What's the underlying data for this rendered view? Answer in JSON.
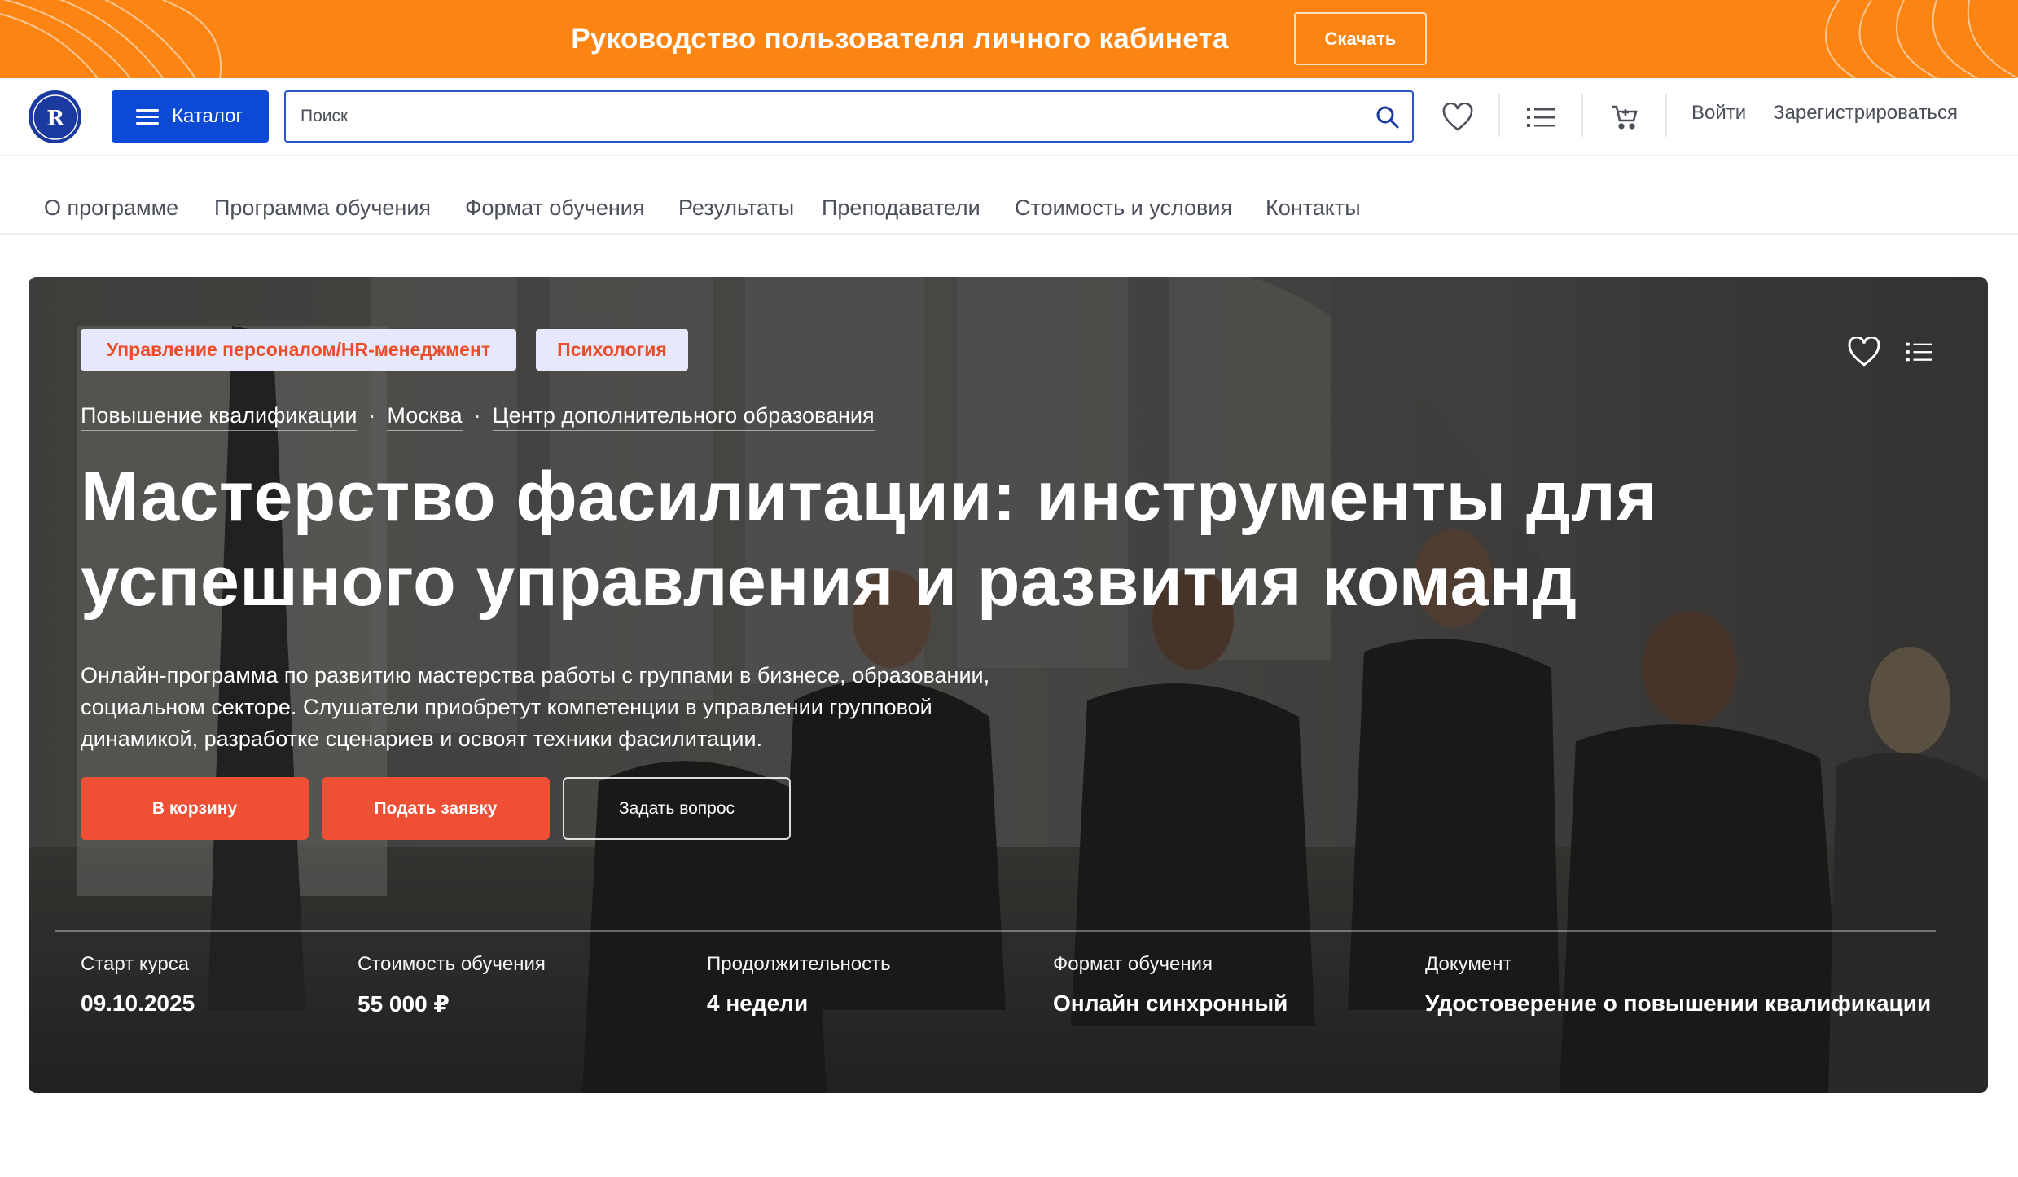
{
  "banner": {
    "text": "Руководство пользователя личного кабинета",
    "button": "Скачать",
    "color": "#fb8412"
  },
  "header": {
    "logo_icon": "hse-logo-icon",
    "catalog_label": "Каталог",
    "search_placeholder": "Поиск",
    "login": "Войти",
    "register": "Зарегистрироваться",
    "accent": "#0c4ad6"
  },
  "nav": {
    "items": [
      {
        "label": "О программе"
      },
      {
        "label": "Программа обучения"
      },
      {
        "label": "Формат обучения"
      },
      {
        "label": "Результаты"
      },
      {
        "label": "Преподаватели"
      },
      {
        "label": "Стоимость и условия"
      },
      {
        "label": "Контакты"
      }
    ]
  },
  "hero": {
    "tags": [
      {
        "label": "Управление персоналом/HR-менеджмент"
      },
      {
        "label": "Психология"
      }
    ],
    "crumbs": [
      "Повышение квалификации",
      "Москва",
      "Центр дополнительного образования"
    ],
    "title": "Мастерство фасилитации: инструменты для успешного управления и развития команд",
    "description": "Онлайн-программа по развитию мастерства работы с группами в бизнесе, образовании, социальном секторе. Слушатели приобретут компетенции в управлении групповой динамикой, разработке сценариев и освоят техники фасилитации.",
    "buttons": {
      "cart": "В корзину",
      "apply": "Подать заявку",
      "ask": "Задать вопрос"
    },
    "button_color": "#ef4f35",
    "stats": [
      {
        "label": "Старт курса",
        "value": "09.10.2025"
      },
      {
        "label": "Стоимость обучения",
        "value": "55 000 ₽"
      },
      {
        "label": "Продолжительность",
        "value": "4 недели"
      },
      {
        "label": "Формат обучения",
        "value": "Онлайн синхронный"
      },
      {
        "label": "Документ",
        "value": "Удостоверение о повышении квалификации"
      }
    ]
  }
}
